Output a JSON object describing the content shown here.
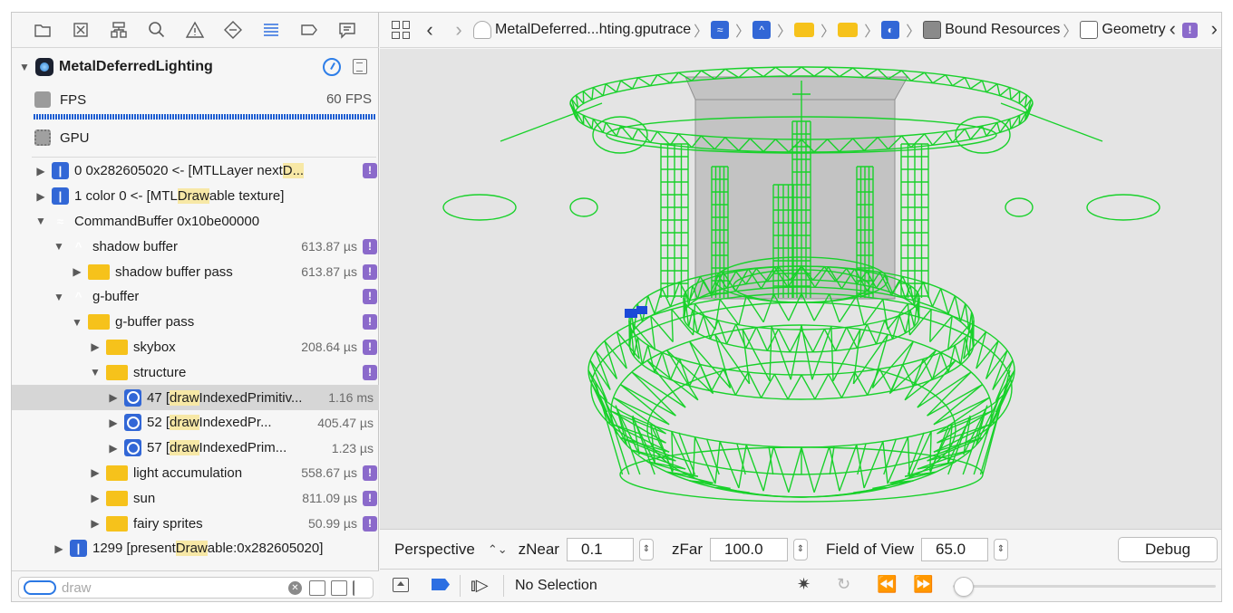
{
  "navigator": {
    "toolbar_icons": [
      "folder-icon",
      "symbol-icon",
      "hierarchy-icon",
      "search-icon",
      "warning-icon",
      "diamond-icon",
      "debug-navigator-icon",
      "breakpoint-icon",
      "report-icon"
    ],
    "app_name": "MetalDeferredLighting",
    "fps_label": "FPS",
    "fps_value": "60 FPS",
    "gpu_label": "GPU",
    "tree": [
      {
        "label_pre": "0 0x282605020 <- [MTLLayer next",
        "label_hl": "D...",
        "label_post": "",
        "icon": "enc",
        "time": "",
        "flag": "!"
      },
      {
        "label_pre": "1 color 0 <- [MTL",
        "label_hl": "Draw",
        "label_post": "able texture]",
        "icon": "enc",
        "time": "",
        "flag": ""
      },
      {
        "label_pre": "CommandBuffer 0x10be00000",
        "label_hl": "",
        "label_post": "",
        "icon": "cmd",
        "time": "",
        "flag": ""
      },
      {
        "label_pre": "shadow buffer",
        "label_hl": "",
        "label_post": "",
        "icon": "pass",
        "time": "613.87 µs",
        "flag": "!"
      },
      {
        "label_pre": "shadow buffer pass",
        "label_hl": "",
        "label_post": "",
        "icon": "folder",
        "time": "613.87 µs",
        "flag": "!"
      },
      {
        "label_pre": "g-buffer",
        "label_hl": "",
        "label_post": "",
        "icon": "pass",
        "time": "",
        "flag": "!"
      },
      {
        "label_pre": "g-buffer pass",
        "label_hl": "",
        "label_post": "",
        "icon": "folder",
        "time": "",
        "flag": "!"
      },
      {
        "label_pre": "skybox",
        "label_hl": "",
        "label_post": "",
        "icon": "folder",
        "time": "208.64 µs",
        "flag": "!"
      },
      {
        "label_pre": "structure",
        "label_hl": "",
        "label_post": "",
        "icon": "folder",
        "time": "",
        "flag": "!"
      },
      {
        "label_pre": "47 [",
        "label_hl": "draw",
        "label_post": "IndexedPrimitiv...",
        "icon": "draw",
        "time": "1.16 ms",
        "flag": ""
      },
      {
        "label_pre": "52 [",
        "label_hl": "draw",
        "label_post": "IndexedPr...",
        "icon": "draw",
        "time": "405.47 µs",
        "flag": ""
      },
      {
        "label_pre": "57 [",
        "label_hl": "draw",
        "label_post": "IndexedPrim...",
        "icon": "draw",
        "time": "1.23 µs",
        "flag": ""
      },
      {
        "label_pre": "light accumulation",
        "label_hl": "",
        "label_post": "",
        "icon": "folder",
        "time": "558.67 µs",
        "flag": "!"
      },
      {
        "label_pre": "sun",
        "label_hl": "",
        "label_post": "",
        "icon": "folder",
        "time": "811.09 µs",
        "flag": "!"
      },
      {
        "label_pre": "fairy sprites",
        "label_hl": "",
        "label_post": "",
        "icon": "folder",
        "time": "50.99 µs",
        "flag": "!"
      },
      {
        "label_pre": "1299 [present",
        "label_hl": "Draw",
        "label_post": "able:0x282605020]",
        "icon": "enc",
        "time": "",
        "flag": ""
      }
    ],
    "filter": {
      "placeholder": "draw",
      "value": ""
    }
  },
  "jumpbar": {
    "file": "MetalDeferred...hting.gputrace",
    "trace_badge": "TRACE",
    "bound_resources": "Bound Resources",
    "geometry": "Geometry",
    "issue_badge": "!"
  },
  "viewport": {
    "wire_color": "#19d12b",
    "background_color": "#e4e4e4",
    "camera_marker_color": "#1b49d8"
  },
  "view_controls": {
    "projection": "Perspective",
    "znear_label": "zNear",
    "znear_value": "0.1",
    "zfar_label": "zFar",
    "zfar_value": "100.0",
    "fov_label": "Field of View",
    "fov_value": "65.0",
    "debug_label": "Debug"
  },
  "debug_bar": {
    "selection": "No Selection",
    "slider_value": 0.04
  }
}
